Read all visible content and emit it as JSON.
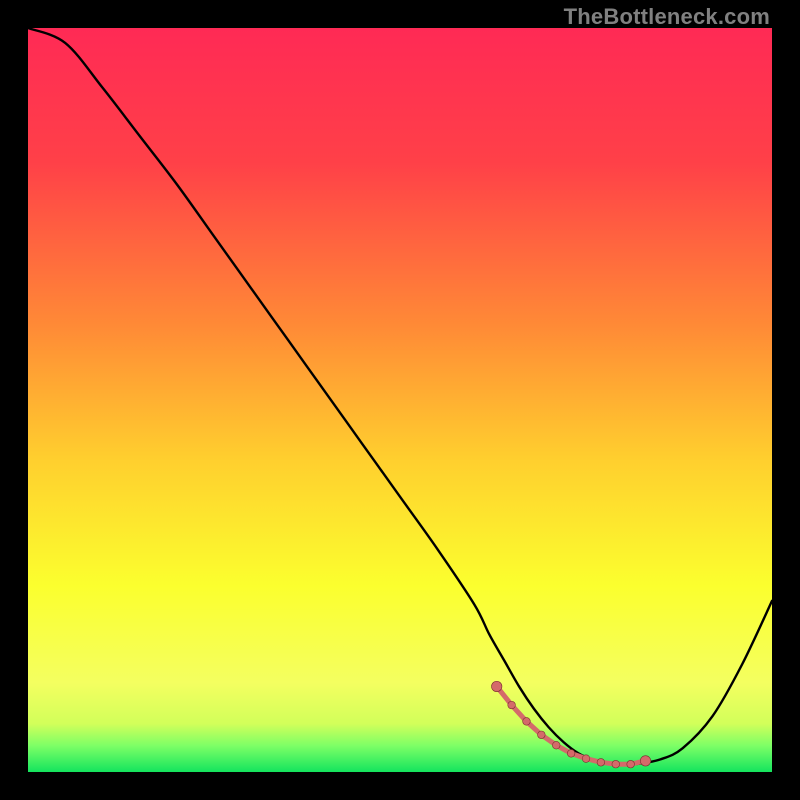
{
  "watermark": "TheBottleneck.com",
  "colors": {
    "bg_black": "#000000",
    "grad_top": "#ff2a55",
    "grad_mid1": "#ff6a3a",
    "grad_mid2": "#ffd13a",
    "grad_mid3": "#f8ff3a",
    "grad_green_light": "#b6ff5a",
    "grad_green": "#1ee865",
    "curve_stroke": "#000000",
    "marker_fill": "#d46a6a",
    "marker_dark": "#7a2e2e",
    "watermark_gray": "#808080"
  },
  "chart_data": {
    "type": "line",
    "title": "",
    "xlabel": "",
    "ylabel": "",
    "xlim": [
      0,
      100
    ],
    "ylim": [
      0,
      100
    ],
    "series": [
      {
        "name": "bottleneck-curve",
        "x": [
          0,
          5,
          10,
          15,
          20,
          25,
          30,
          35,
          40,
          45,
          50,
          55,
          60,
          62,
          64,
          66,
          68,
          70,
          72,
          74,
          76,
          78,
          80,
          82,
          85,
          88,
          92,
          96,
          100
        ],
        "y": [
          100,
          98,
          92,
          85.5,
          79,
          72,
          65,
          58,
          51,
          44,
          37,
          30,
          22.5,
          18.5,
          15,
          11.5,
          8.5,
          6,
          4,
          2.5,
          1.6,
          1.1,
          1.0,
          1.1,
          1.7,
          3.2,
          7.5,
          14.5,
          23
        ]
      }
    ],
    "markers": {
      "name": "flat-region-markers",
      "x": [
        63,
        65,
        67,
        69,
        71,
        73,
        75,
        77,
        79,
        81,
        83
      ],
      "y": [
        11.5,
        9,
        6.8,
        5,
        3.6,
        2.5,
        1.8,
        1.3,
        1.05,
        1.05,
        1.5
      ]
    },
    "gradient_stops": [
      {
        "offset": 0.0,
        "color": "#ff2a55"
      },
      {
        "offset": 0.18,
        "color": "#ff4048"
      },
      {
        "offset": 0.4,
        "color": "#ff8a36"
      },
      {
        "offset": 0.58,
        "color": "#ffcf2e"
      },
      {
        "offset": 0.75,
        "color": "#fbff2e"
      },
      {
        "offset": 0.88,
        "color": "#f4ff60"
      },
      {
        "offset": 0.935,
        "color": "#d2ff5a"
      },
      {
        "offset": 0.965,
        "color": "#7cff66"
      },
      {
        "offset": 1.0,
        "color": "#14e45e"
      }
    ]
  }
}
